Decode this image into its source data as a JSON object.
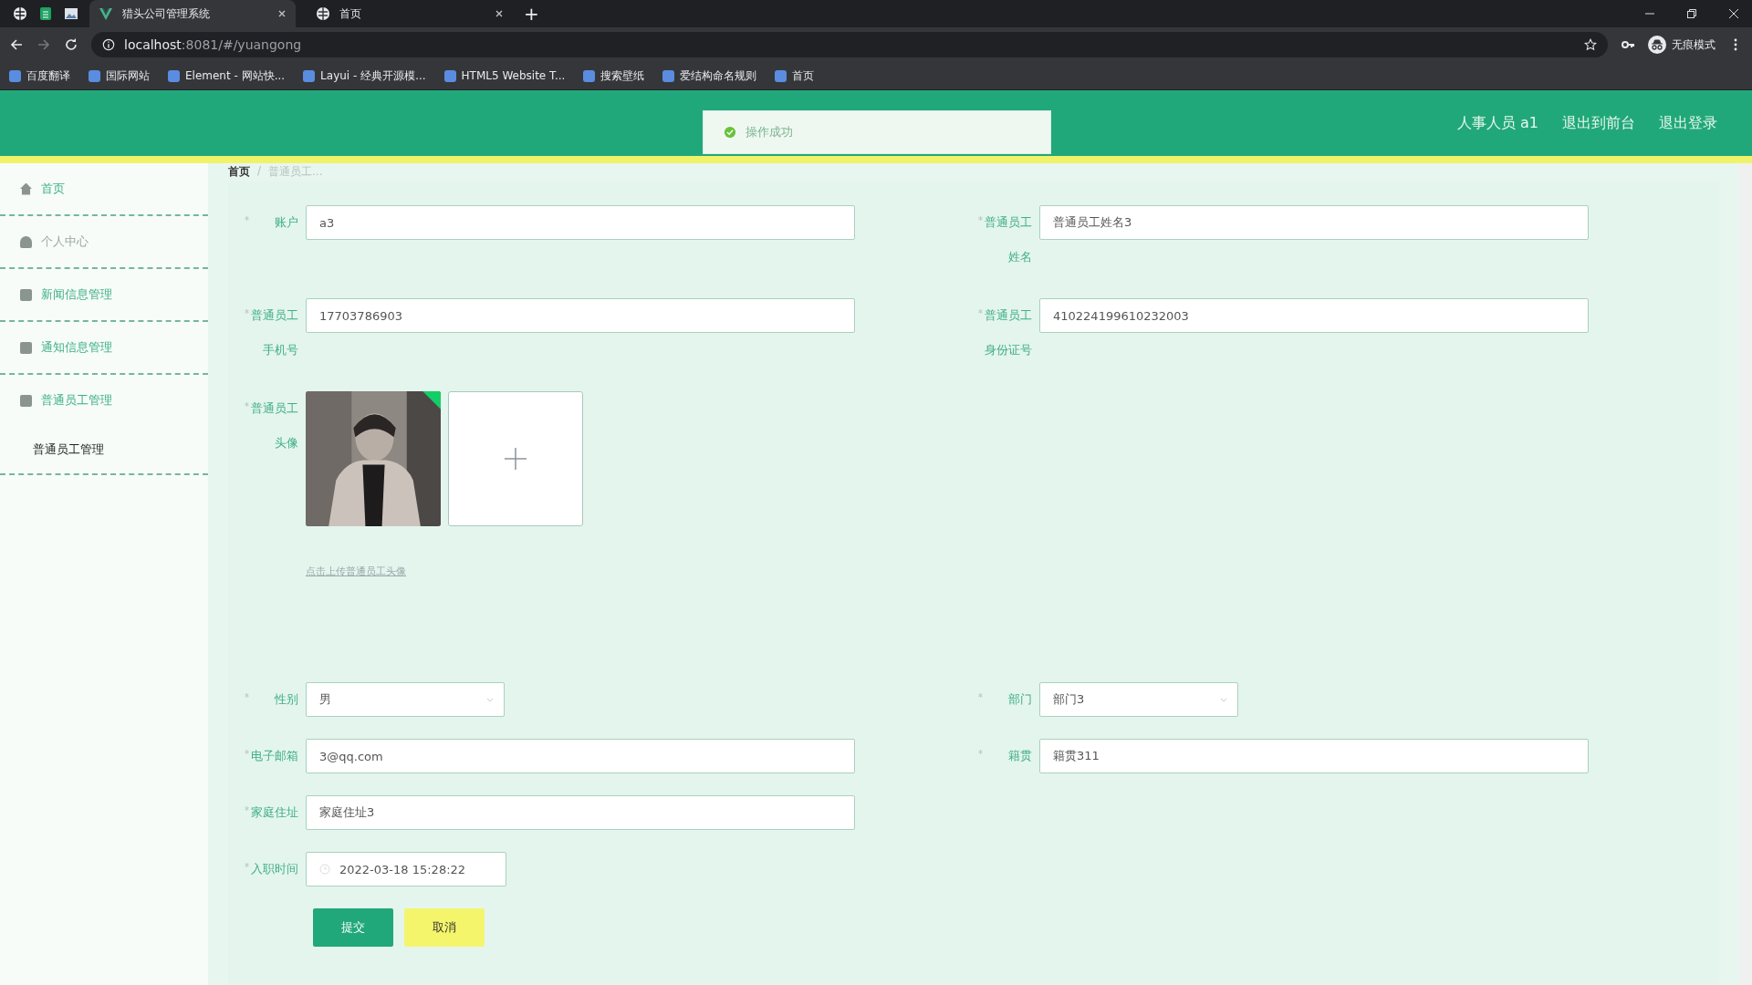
{
  "browser": {
    "tabs": [
      {
        "title": "猎头公司管理系统",
        "selected": true
      },
      {
        "title": "首页",
        "selected": false
      }
    ],
    "new_tab": "+",
    "address": {
      "host": "localhost",
      "rest": ":8081/#/yuangong"
    },
    "bookmarks": [
      "百度翻译",
      "国际网站",
      "Element - 网站快...",
      "Layui - 经典开源模...",
      "HTML5 Website T...",
      "搜索壁纸",
      "爱结构命名规则",
      "首页"
    ],
    "profile": "无痕模式"
  },
  "header": {
    "links": [
      "人事人员 a1",
      "退出到前台",
      "退出登录"
    ]
  },
  "toast": {
    "message": "操作成功"
  },
  "sidebar": {
    "items": [
      {
        "label": "首页"
      },
      {
        "label": "个人中心"
      },
      {
        "label": "新闻信息管理"
      },
      {
        "label": "通知信息管理"
      },
      {
        "label": "普通员工管理",
        "children": [
          {
            "label": "普通员工管理"
          }
        ]
      }
    ]
  },
  "breadcrumb": {
    "items": [
      "首页",
      "普通员工..."
    ],
    "separator": "/"
  },
  "form": {
    "rows": [
      [
        {
          "kind": "input",
          "label": "账户",
          "required": true,
          "value": "a3"
        },
        {
          "kind": "input",
          "label": "普通员工姓名",
          "required": true,
          "value": "普通员工姓名3"
        }
      ],
      [
        {
          "kind": "input",
          "label": "普通员工手机号",
          "required": true,
          "value": "17703786903"
        },
        {
          "kind": "input",
          "label": "普通员工身份证号",
          "required": true,
          "value": "410224199610232003"
        }
      ],
      [
        {
          "kind": "upload",
          "label": "普通员工头像",
          "required": true,
          "uploaded": true,
          "hint": "点击上传普通员工头像"
        }
      ],
      [
        {
          "kind": "select",
          "label": "性别",
          "required": true,
          "value": "男"
        },
        {
          "kind": "select",
          "label": "部门",
          "required": true,
          "value": "部门3"
        }
      ],
      [
        {
          "kind": "input",
          "label": "电子邮箱",
          "required": true,
          "value": "3@qq.com"
        },
        {
          "kind": "input",
          "label": "籍贯",
          "required": true,
          "value": "籍贯311"
        }
      ],
      [
        {
          "kind": "input",
          "label": "家庭住址",
          "required": true,
          "value": "家庭住址3"
        }
      ],
      [
        {
          "kind": "date",
          "label": "入职时间",
          "required": true,
          "value": "2022-03-18 15:28:22"
        }
      ]
    ],
    "buttons": [
      {
        "label": "提交",
        "kind": "primary"
      },
      {
        "label": "取消",
        "kind": "cancel"
      }
    ]
  }
}
